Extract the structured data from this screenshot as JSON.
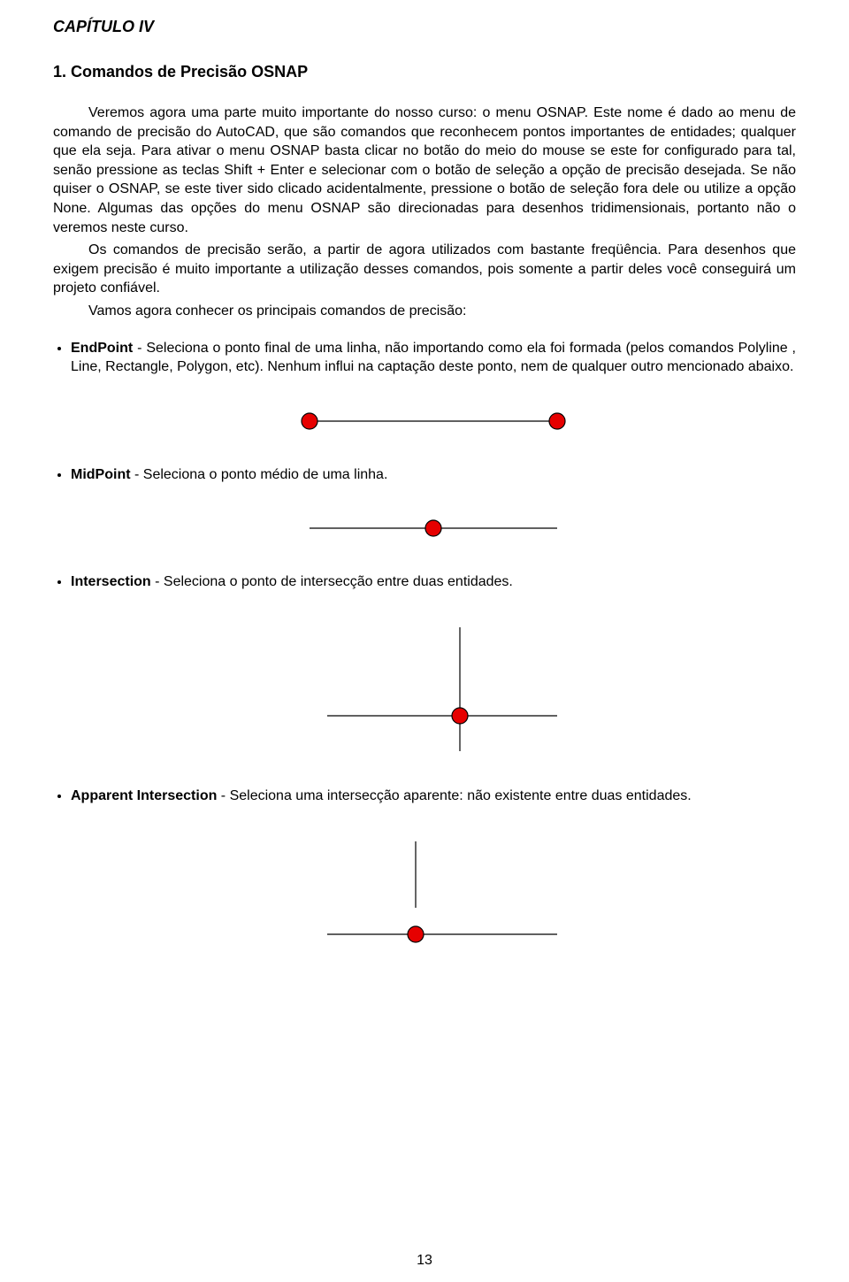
{
  "chapter": "CAPÍTULO IV",
  "section_title": "1. Comandos de Precisão OSNAP",
  "paragraphs": {
    "p1": "Veremos agora uma parte muito importante do nosso curso: o menu OSNAP. Este nome é dado ao menu de comando de precisão do AutoCAD, que são comandos que reconhecem pontos importantes de entidades; qualquer que ela seja. Para ativar o menu OSNAP basta clicar no botão do meio do mouse se este for configurado para tal, senão pressione as teclas Shift + Enter e selecionar com o botão de seleção a opção de precisão desejada. Se não quiser o OSNAP, se este tiver sido clicado acidentalmente, pressione o botão de seleção fora dele ou utilize a opção None. Algumas das opções do menu OSNAP são direcionadas para desenhos tridimensionais, portanto não o veremos neste curso.",
    "p2": "Os comandos de precisão serão, a partir de agora utilizados com bastante freqüência. Para desenhos que exigem precisão é muito importante a utilização desses comandos, pois somente a partir deles você conseguirá um projeto confiável.",
    "p3": "Vamos agora conhecer os principais comandos de precisão:"
  },
  "items": {
    "endpoint": {
      "term": "EndPoint",
      "desc": " - Seleciona o ponto final de uma linha, não importando como ela foi formada (pelos comandos Polyline , Line, Rectangle, Polygon, etc). Nenhum influi na captação deste ponto, nem de qualquer outro mencionado abaixo."
    },
    "midpoint": {
      "term": "MidPoint",
      "desc": " - Seleciona o ponto médio de uma linha."
    },
    "intersection": {
      "term": "Intersection",
      "desc": " - Seleciona o ponto de intersecção entre duas entidades."
    },
    "apparent": {
      "term": "Apparent Intersection",
      "desc": " - Seleciona uma intersecção aparente: não existente entre duas entidades."
    }
  },
  "page_number": "13"
}
